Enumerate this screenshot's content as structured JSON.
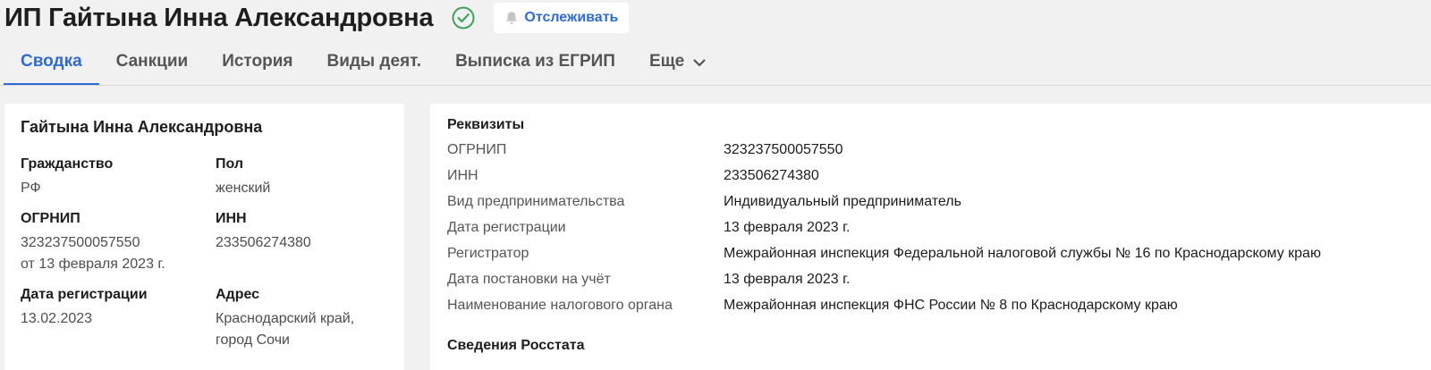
{
  "header": {
    "title": "ИП Гайтына Инна Александровна",
    "status_icon": "check-circle-icon",
    "follow_button": {
      "label": "Отслеживать",
      "icon": "bell-icon"
    },
    "colors": {
      "accent": "#2e6bd6",
      "status": "#3ca35a",
      "background": "#f1f1f1"
    }
  },
  "tabs": [
    {
      "label": "Сводка",
      "active": true
    },
    {
      "label": "Санкции",
      "active": false
    },
    {
      "label": "История",
      "active": false
    },
    {
      "label": "Виды деят.",
      "active": false
    },
    {
      "label": "Выписка из ЕГРИП",
      "active": false
    },
    {
      "label": "Еще",
      "active": false,
      "icon": "chevron-down-icon"
    }
  ],
  "summary_card": {
    "name": "Гайтына Инна Александровна",
    "fields": [
      {
        "label": "Гражданство",
        "lines": [
          "РФ"
        ]
      },
      {
        "label": "Пол",
        "lines": [
          "женский"
        ]
      },
      {
        "label": "ОГРНИП",
        "lines": [
          "323237500057550",
          "от 13 февраля 2023 г."
        ]
      },
      {
        "label": "ИНН",
        "lines": [
          "233506274380"
        ]
      },
      {
        "label": "Дата регистрации",
        "lines": [
          "13.02.2023"
        ]
      },
      {
        "label": "Адрес",
        "lines": [
          "Краснодарский край,",
          "город Сочи"
        ]
      }
    ]
  },
  "details_card": {
    "requisites_title": "Реквизиты",
    "rows": [
      {
        "label": "ОГРНИП",
        "value": "323237500057550"
      },
      {
        "label": "ИНН",
        "value": "233506274380"
      },
      {
        "label": "Вид предпринимательства",
        "value": "Индивидуальный предприниматель"
      },
      {
        "label": "Дата регистрации",
        "value": "13 февраля 2023 г."
      },
      {
        "label": "Регистратор",
        "value": "Межрайонная инспекция Федеральной налоговой службы № 16 по Краснодарскому краю"
      },
      {
        "label": "Дата постановки на учёт",
        "value": "13 февраля 2023 г."
      },
      {
        "label": "Наименование налогового органа",
        "value": "Межрайонная инспекция ФНС России № 8 по Краснодарскому краю"
      }
    ],
    "rosstat_title": "Сведения Росстата"
  }
}
